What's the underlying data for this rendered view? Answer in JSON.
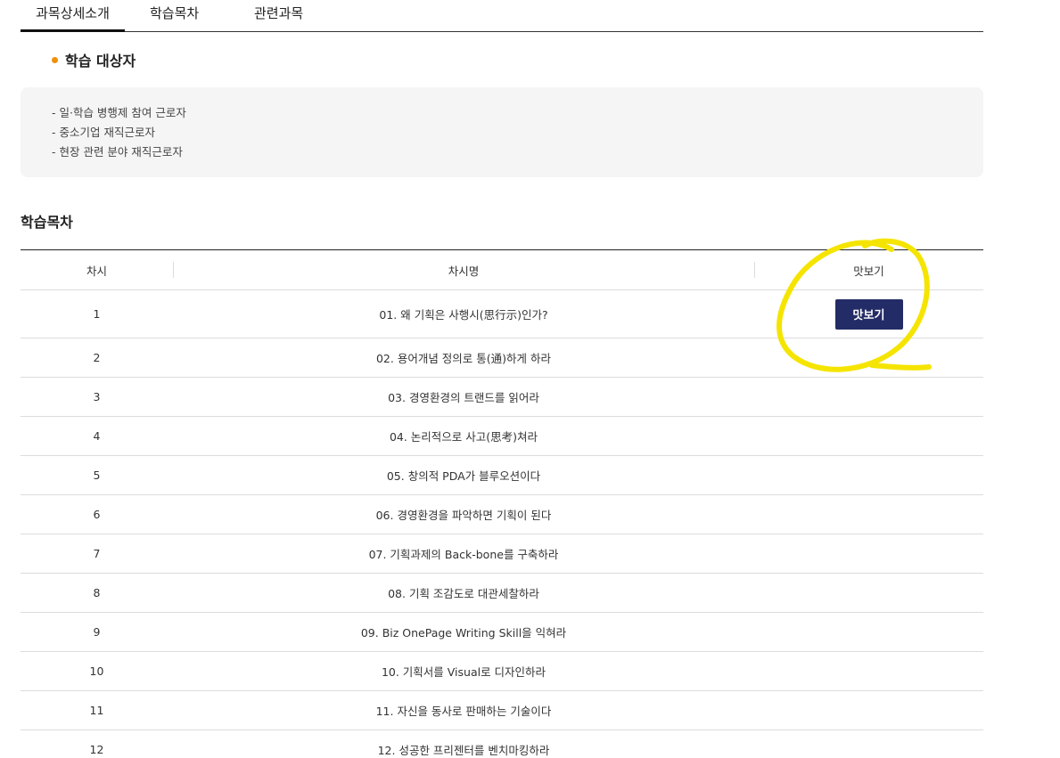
{
  "tabs": [
    {
      "label": "과목상세소개",
      "active": true
    },
    {
      "label": "학습목차",
      "active": false
    },
    {
      "label": "관련과목",
      "active": false
    }
  ],
  "target": {
    "title": "학습 대상자",
    "items": [
      "- 일·학습 병행제 참여 근로자",
      "- 중소기업 재직근로자",
      "- 현장 관련 분야 재직근로자"
    ]
  },
  "toc": {
    "title": "학습목차",
    "headers": {
      "no": "차시",
      "name": "차시명",
      "preview": "맛보기"
    },
    "preview_button": "맛보기",
    "rows": [
      {
        "no": "1",
        "name": "01. 왜 기획은 사행시(思行示)인가?"
      },
      {
        "no": "2",
        "name": "02. 용어개념 정의로 통(通)하게 하라"
      },
      {
        "no": "3",
        "name": "03. 경영환경의 트랜드를 읽어라"
      },
      {
        "no": "4",
        "name": "04. 논리적으로 사고(思考)쳐라"
      },
      {
        "no": "5",
        "name": "05. 창의적 PDA가 블루오션이다"
      },
      {
        "no": "6",
        "name": "06. 경영환경을 파악하면 기획이 된다"
      },
      {
        "no": "7",
        "name": "07. 기획과제의 Back-bone를 구축하라"
      },
      {
        "no": "8",
        "name": "08. 기획 조감도로 대관세찰하라"
      },
      {
        "no": "9",
        "name": "09. Biz OnePage Writing Skill을 익혀라"
      },
      {
        "no": "10",
        "name": "10. 기획서를 Visual로 디자인하라"
      },
      {
        "no": "11",
        "name": "11. 자신을 동사로 판매하는 기술이다"
      },
      {
        "no": "12",
        "name": "12. 성공한 프리젠터를 벤치마킹하라"
      }
    ]
  },
  "colors": {
    "accent_dot": "#f0900a",
    "button_bg": "#232c66",
    "annotation": "#f5e400"
  }
}
